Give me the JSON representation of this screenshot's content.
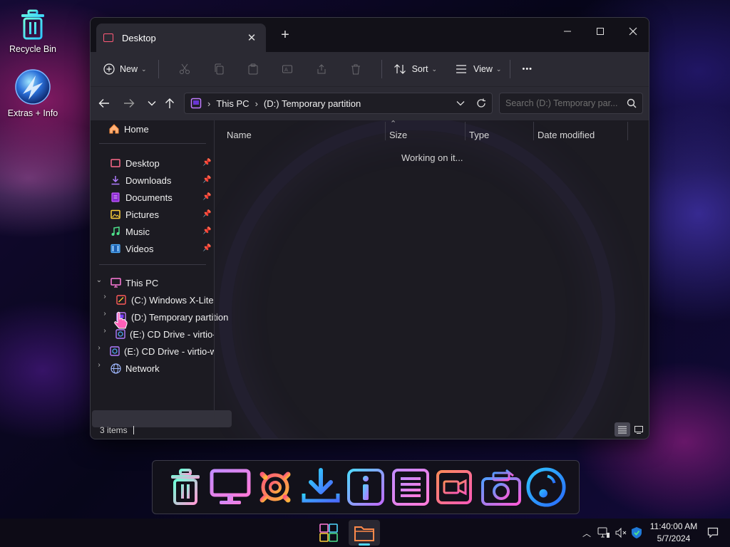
{
  "desktop": {
    "icons": [
      {
        "label": "Recycle Bin",
        "icon": "recycle-bin-icon"
      },
      {
        "label": "Extras + Info",
        "icon": "extras-info-icon"
      }
    ]
  },
  "window": {
    "tab_title": "Desktop",
    "toolbar": {
      "new_label": "New",
      "sort_label": "Sort",
      "view_label": "View",
      "more_label": "•••"
    },
    "address": {
      "crumbs": [
        "This PC",
        "(D:) Temporary partition"
      ],
      "search_placeholder": "Search (D:) Temporary par..."
    },
    "sidebar": {
      "home": "Home",
      "quick_access": [
        {
          "label": "Desktop",
          "icon": "desktop-folder-icon",
          "color": "#ff6b8a"
        },
        {
          "label": "Downloads",
          "icon": "downloads-folder-icon",
          "color": "#b07cff"
        },
        {
          "label": "Documents",
          "icon": "documents-folder-icon",
          "color": "#c45cff"
        },
        {
          "label": "Pictures",
          "icon": "pictures-folder-icon",
          "color": "#ffd23a"
        },
        {
          "label": "Music",
          "icon": "music-folder-icon",
          "color": "#4de08a"
        },
        {
          "label": "Videos",
          "icon": "videos-folder-icon",
          "color": "#4fb0ff"
        }
      ],
      "this_pc": "This PC",
      "drives": [
        {
          "label": "(C:) Windows X-Lite",
          "icon": "drive-c-icon"
        },
        {
          "label": "(D:) Temporary partition",
          "icon": "drive-d-icon"
        },
        {
          "label": "(E:) CD Drive - virtio-",
          "icon": "cd-drive-icon"
        }
      ],
      "cd_root": "(E:) CD Drive - virtio-w",
      "network": "Network"
    },
    "columns": [
      "Name",
      "Size",
      "Type",
      "Date modified"
    ],
    "status_message": "Working on it...",
    "item_count": "3 items"
  },
  "dock": {
    "icons": [
      "trash-icon",
      "monitor-icon",
      "settings-gear-icon",
      "download-icon",
      "info-icon",
      "list-icon",
      "video-camera-icon",
      "photo-camera-icon",
      "music-note-icon"
    ]
  },
  "taskbar": {
    "time": "11:40:00 AM",
    "date": "5/7/2024"
  }
}
